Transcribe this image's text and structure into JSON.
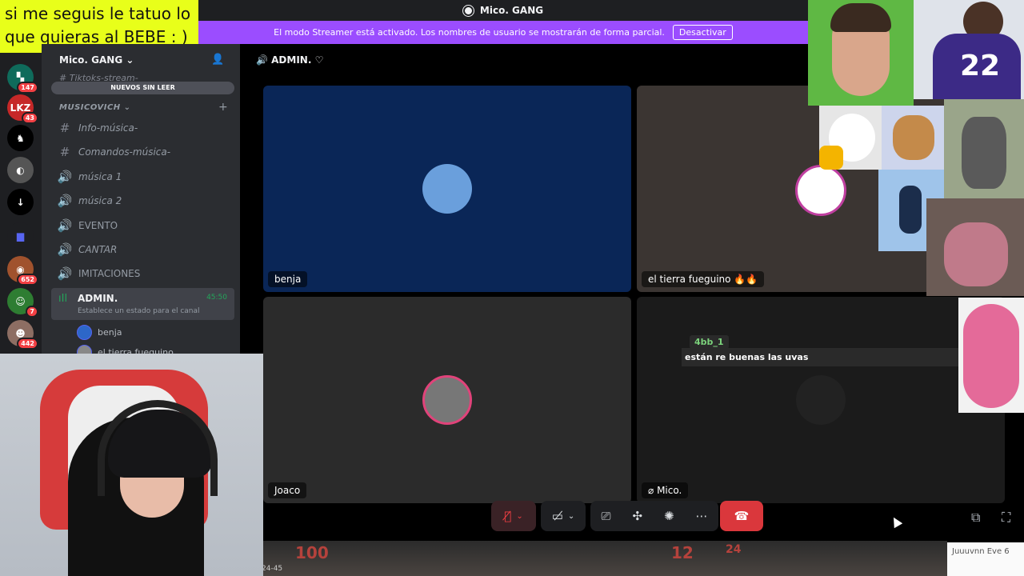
{
  "overlay_text": "si me seguis le tatuo lo que quieras al BEBE : )",
  "window": {
    "title": "Mico. GANG"
  },
  "streamer_banner": {
    "message": "El modo Streamer está activado. Los nombres de usuario se mostrarán de forma parcial.",
    "button_label": "Desactivar"
  },
  "server_rail": {
    "badges": [
      "147",
      "43",
      "652",
      "7",
      "442"
    ],
    "labels": [
      "LKZ"
    ]
  },
  "sidebar": {
    "server_name": "Mico. GANG",
    "hidden_channel": "Tiktoks-stream-",
    "unread_pill": "NUEVOS SIN LEER",
    "category": "MUSICOVICH",
    "channels": [
      {
        "name": "Info-música-",
        "type": "text"
      },
      {
        "name": "Comandos-música-",
        "type": "text"
      },
      {
        "name": "música 1",
        "type": "voice"
      },
      {
        "name": "música 2",
        "type": "voice"
      },
      {
        "name": "EVENTO",
        "type": "voice"
      },
      {
        "name": "CANTAR",
        "type": "voice"
      },
      {
        "name": "IMITACIONES",
        "type": "voice"
      }
    ],
    "active_channel": {
      "name": "ADMIN.",
      "time": "45:50",
      "status": "Establece un estado para el canal"
    },
    "members": [
      "benja",
      "el tierra fueguino"
    ]
  },
  "call": {
    "header": "ADMIN.",
    "tiles": [
      {
        "name": "benja"
      },
      {
        "name": "el tierra fueguino 🔥🔥"
      },
      {
        "name": "Joaco"
      },
      {
        "name": "Mico."
      }
    ],
    "chat_overlay": {
      "user": "4bb_1",
      "message": "están re buenas las uvas"
    }
  },
  "game_hud": {
    "left": "100",
    "mid": "12",
    "right": "24",
    "clock": "24-45"
  },
  "watermark": "Juuuvnn Eve 6",
  "icons": {
    "mic": "mic-off-icon",
    "camera": "camera-off-icon",
    "share": "screen-share-icon",
    "activities": "activities-icon",
    "soundboard": "soundboard-icon",
    "more": "more-icon",
    "leave": "leave-call-icon",
    "popout": "popout-icon",
    "fullscreen": "fullscreen-icon"
  },
  "colors": {
    "streamer_banner": "#9b4dff",
    "leave": "#da373c",
    "voice_active": "#23a55a",
    "overlay_bg": "#e8ff1a"
  }
}
